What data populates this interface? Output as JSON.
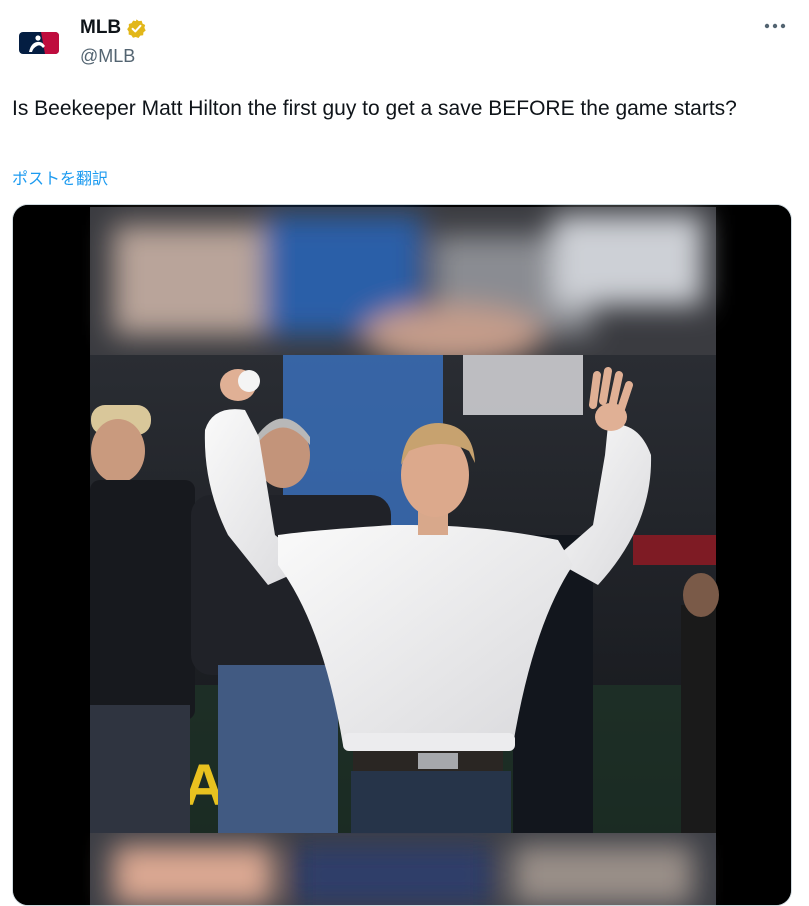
{
  "author": {
    "display_name": "MLB",
    "handle": "@MLB",
    "verified_badge": "verified-gold-icon",
    "badge_color": "#e2b719",
    "avatar": "mlb-logo"
  },
  "tweet": {
    "text": "Is Beekeeper Matt Hilton the first guy to get a save BEFORE the game starts?",
    "translate_label": "ポストを翻訳"
  },
  "media": {
    "type": "video",
    "description_icon": "video-frame"
  },
  "colors": {
    "link": "#1d9bf0",
    "text": "#0f1419",
    "secondary": "#536471"
  }
}
